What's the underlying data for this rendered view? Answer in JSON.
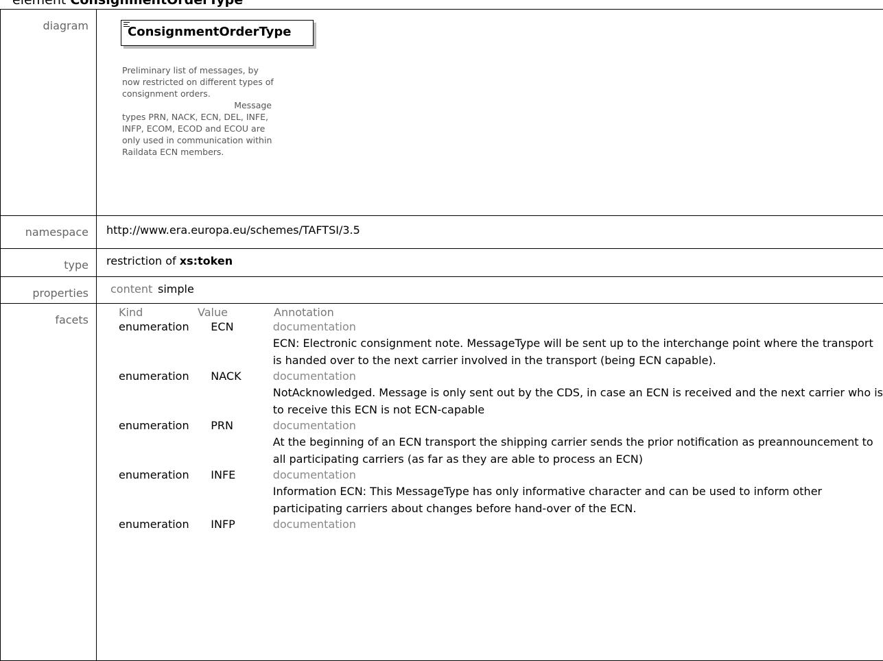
{
  "heading": {
    "prefix": "element ",
    "name": "ConsignmentOrderType"
  },
  "labels": {
    "diagram": "diagram",
    "namespace": "namespace",
    "type": "type",
    "properties": "properties",
    "facets": "facets"
  },
  "diagram": {
    "box_title": "ConsignmentOrderType",
    "doc_line1": "Preliminary list of messages, by now restricted on different types of consignment orders.",
    "doc_line2": "Message",
    "doc_line3": "types PRN, NACK, ECN, DEL, INFE, INFP, ECOM, ECOD and ECOU are only used in communication within Raildata ECN members."
  },
  "namespace": "http://www.era.europa.eu/schemes/TAFTSI/3.5",
  "type": {
    "prefix": "restriction of ",
    "base": "xs:token"
  },
  "properties": {
    "key": "content",
    "value": "simple"
  },
  "facets": {
    "headers": [
      "Kind",
      "Value",
      "Annotation"
    ],
    "rows": [
      {
        "kind": "enumeration",
        "value": "ECN",
        "doc_label": "documentation",
        "doc": "ECN: Electronic consignment note. MessageType will be sent up to the interchange point where the transport is handed over to the next carrier involved in the transport (being ECN capable)."
      },
      {
        "kind": "enumeration",
        "value": "NACK",
        "doc_label": "documentation",
        "doc": "NotAcknowledged. Message is only sent out by the CDS, in case an ECN is received and the next carrier who is to receive this ECN is not ECN-capable"
      },
      {
        "kind": "enumeration",
        "value": "PRN",
        "doc_label": "documentation",
        "doc": "At the beginning of an ECN transport the shipping carrier sends the prior notification as preannouncement to all participating carriers (as far as they are able to process an ECN)"
      },
      {
        "kind": "enumeration",
        "value": "INFE",
        "doc_label": "documentation",
        "doc": "Information ECN: This MessageType has only informative character and can be used to inform other participating carriers about changes before hand-over of the ECN."
      },
      {
        "kind": "enumeration",
        "value": "INFP",
        "doc_label": "documentation",
        "doc": ""
      }
    ]
  }
}
